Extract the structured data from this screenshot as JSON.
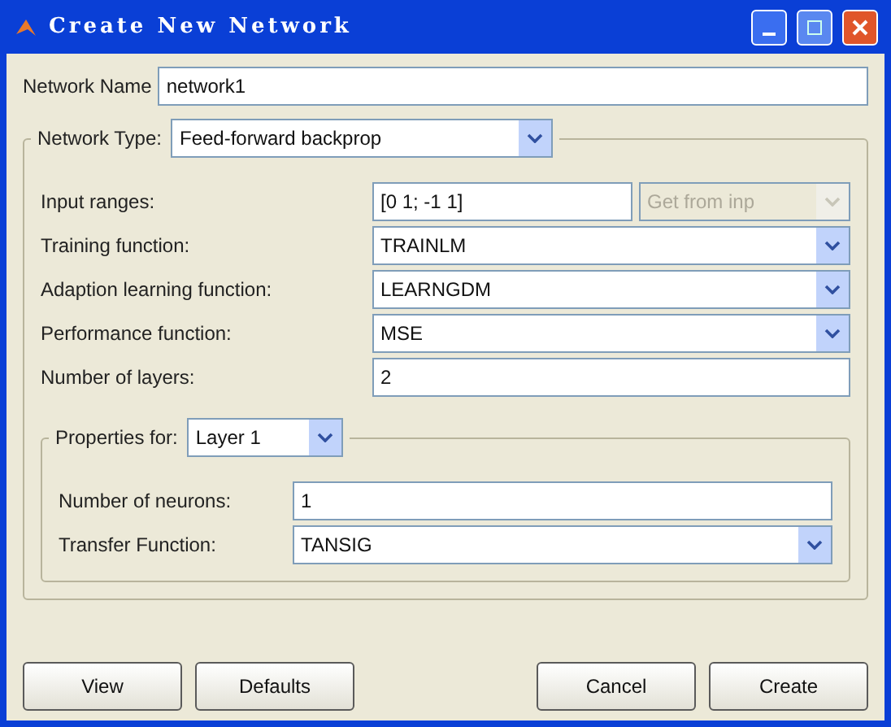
{
  "window": {
    "title": "Create New Network"
  },
  "network_name": {
    "label": "Network Name",
    "value": "network1"
  },
  "network_type": {
    "label": "Network Type:",
    "value": "Feed-forward backprop"
  },
  "rows": [
    {
      "kind": "field",
      "label": "Input ranges:",
      "value": "[0 1; -1 1]",
      "side": {
        "label": "Get from inp",
        "disabled": true
      }
    },
    {
      "kind": "dropdown",
      "label": "Training function:",
      "value": "TRAINLM"
    },
    {
      "kind": "dropdown",
      "label": "Adaption learning function:",
      "value": "LEARNGDM"
    },
    {
      "kind": "dropdown",
      "label": "Performance function:",
      "value": "MSE"
    },
    {
      "kind": "field",
      "label": "Number of layers:",
      "value": "2"
    }
  ],
  "properties": {
    "label": "Properties for:",
    "value": "Layer 1",
    "rows": [
      {
        "kind": "field",
        "label": "Number of neurons:",
        "value": "1"
      },
      {
        "kind": "dropdown",
        "label": "Transfer Function:",
        "value": "TANSIG"
      }
    ]
  },
  "left_buttons": [
    "View",
    "Defaults"
  ],
  "right_buttons": [
    "Cancel",
    "Create"
  ]
}
